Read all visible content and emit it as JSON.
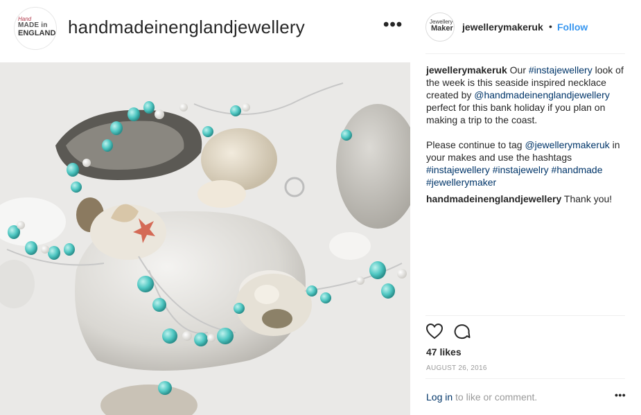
{
  "profile": {
    "username": "handmadeinenglandjewellery",
    "avatar_line1": "Hand",
    "avatar_line2": "MADE in",
    "avatar_line3": "ENGLAND"
  },
  "post": {
    "author": "jewellerymakeruk",
    "author_avatar_line1": "Jewellery",
    "author_avatar_line2": "Maker",
    "separator": "•",
    "follow_label": "Follow",
    "caption": {
      "user": "jewellerymakeruk",
      "t1": " Our ",
      "tag1": "#instajewellery",
      "t2": " look of the week is this seaside inspired necklace created by ",
      "mention1": "@handmadeinenglandjewellery",
      "t3": " perfect for this bank holiday if you plan on making a trip to the coast.",
      "t4": "Please continue to tag ",
      "mention2": "@jewellerymakeruk",
      "t5": " in your makes and use the hashtags ",
      "tag2": "#instajewellery",
      "tag3": "#instajewelry",
      "tag4": "#handmade",
      "tag5": "#jewellerymaker"
    },
    "reply": {
      "user": "handmadeinenglandjewellery",
      "text": " Thank you!"
    },
    "likes_text": "47 likes",
    "date": "AUGUST 26, 2016",
    "login_link": "Log in",
    "login_rest": " to like or comment.",
    "icons": [
      "heart-icon",
      "comment-icon",
      "more-icon"
    ]
  },
  "colors": {
    "link": "#003569",
    "follow": "#3897f0",
    "muted": "#999999"
  }
}
